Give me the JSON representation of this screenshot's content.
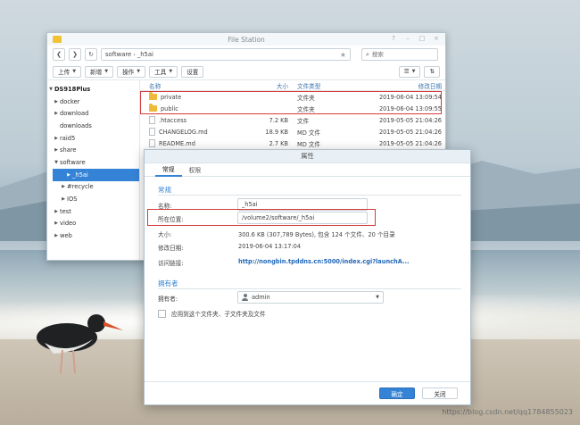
{
  "file_station": {
    "title": "File Station",
    "window_controls": [
      "?",
      "–",
      "□",
      "×"
    ],
    "path": [
      "software",
      "_h5ai"
    ],
    "search_placeholder": "搜索",
    "toolbar": {
      "upload": "上传",
      "create": "新增",
      "action": "操作",
      "tools": "工具",
      "settings": "设置"
    },
    "tree": [
      {
        "label": "DS918Plus",
        "root": true
      },
      {
        "label": "docker"
      },
      {
        "label": "download"
      },
      {
        "label": "downloads"
      },
      {
        "label": "raid5"
      },
      {
        "label": "share"
      },
      {
        "label": "software"
      },
      {
        "label": "_h5ai",
        "selected": true
      },
      {
        "label": "#recycle"
      },
      {
        "label": "IOS"
      },
      {
        "label": "test"
      },
      {
        "label": "video"
      },
      {
        "label": "web"
      }
    ],
    "columns": {
      "name": "名称",
      "size": "大小",
      "type": "文件类型",
      "date": "修改日期"
    },
    "files": [
      {
        "name": "private",
        "size": "",
        "type": "文件夹",
        "date": "2019-06-04 13:09:54",
        "kind": "folder"
      },
      {
        "name": "public",
        "size": "",
        "type": "文件夹",
        "date": "2019-06-04 13:09:55",
        "kind": "folder"
      },
      {
        "name": ".htaccess",
        "size": "7.2 KB",
        "type": "文件",
        "date": "2019-05-05 21:04:26",
        "kind": "file"
      },
      {
        "name": "CHANGELOG.md",
        "size": "18.9 KB",
        "type": "MD 文件",
        "date": "2019-05-05 21:04:26",
        "kind": "file"
      },
      {
        "name": "README.md",
        "size": "2.7 KB",
        "type": "MD 文件",
        "date": "2019-05-05 21:04:26",
        "kind": "file"
      }
    ]
  },
  "properties": {
    "title": "属性",
    "tabs": [
      "常规",
      "权限"
    ],
    "general_section": "常规",
    "name_label": "名称:",
    "name_value": "_h5ai",
    "location_label": "所在位置:",
    "location_value": "/volume2/software/_h5ai",
    "size_label": "大小:",
    "size_value": "300.6 KB (307,789 Bytes), 包含 124 个文件、20 个目录",
    "modified_label": "修改日期:",
    "modified_value": "2019-06-04 13:17:04",
    "url_label": "访问链接:",
    "url_value": "http://nongbin.tpddns.cn:5000/index.cgi?launchA...",
    "owner_section": "拥有者",
    "owner_label": "拥有者:",
    "owner_value": "admin",
    "apply_checkbox": "应用到这个文件夹、子文件夹及文件",
    "ok_button": "确定",
    "close_button": "关闭"
  },
  "watermark": "https://blog.csdn.net/qq1784855023",
  "colors": {
    "accent": "#3583d6",
    "highlight": "#d43c3c",
    "folder": "#f0b93b"
  }
}
